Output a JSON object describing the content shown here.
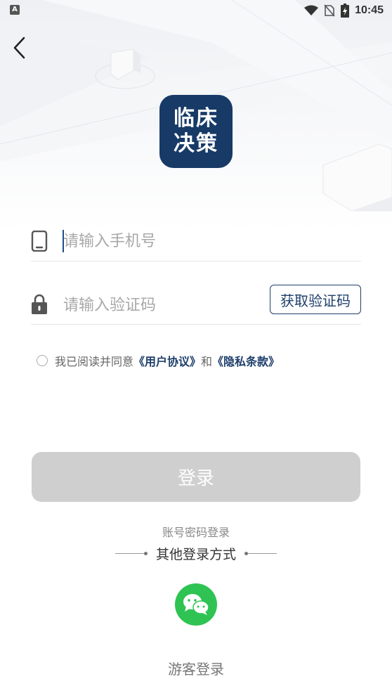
{
  "status_bar": {
    "left_icon_label": "A",
    "time": "10:45",
    "icons": [
      "wifi-icon",
      "no-sim-icon",
      "battery-charging-icon"
    ]
  },
  "back_icon": "chevron-left-icon",
  "logo": {
    "line1": "临床",
    "line2": "决策",
    "bg_color": "#173a67"
  },
  "phone": {
    "placeholder": "请输入手机号",
    "value": "",
    "icon": "phone-icon"
  },
  "code": {
    "placeholder": "请输入验证码",
    "value": "",
    "icon": "lock-icon",
    "button_label": "获取验证码"
  },
  "agreement": {
    "prefix": "我已阅读并同意",
    "user_agreement": "《用户协议》",
    "conjunction": "和",
    "privacy_policy": "《隐私条款》",
    "checked": false
  },
  "login_button": {
    "label": "登录",
    "enabled": false
  },
  "password_login": "账号密码登录",
  "other_login": {
    "title": "其他登录方式",
    "wechat_icon": "wechat-icon"
  },
  "guest_login": "游客登录",
  "colors": {
    "brand": "#1f3f6b",
    "wechat": "#2fc353",
    "disabled_button": "#cfcfcf"
  }
}
